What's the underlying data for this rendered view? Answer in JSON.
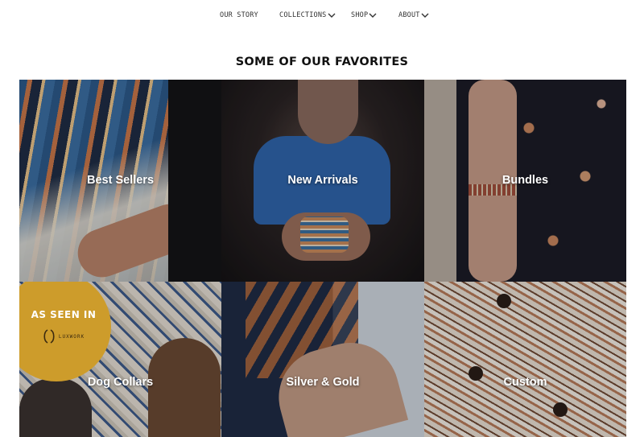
{
  "nav": {
    "items": [
      {
        "label": "OUR STORY",
        "has_dropdown": false
      },
      {
        "label": "COLLECTIONS",
        "has_dropdown": true
      },
      {
        "label": "SHOP",
        "has_dropdown": true
      },
      {
        "label": "ABOUT",
        "has_dropdown": true
      }
    ],
    "chevron_icon": "chevron-down-icon"
  },
  "section": {
    "title": "SOME OF OUR FAVORITES"
  },
  "tiles": [
    {
      "label": "Best Sellers"
    },
    {
      "label": "New Arrivals"
    },
    {
      "label": "Bundles"
    },
    {
      "label": "Dog Collars"
    },
    {
      "label": "Silver & Gold"
    },
    {
      "label": "Custom"
    }
  ],
  "badge": {
    "text": "AS SEEN IN",
    "logo_text": "LUXWORK",
    "color": "#cd9c2b"
  },
  "colors": {
    "text_dark": "#111111",
    "tile_label": "#ffffff"
  }
}
